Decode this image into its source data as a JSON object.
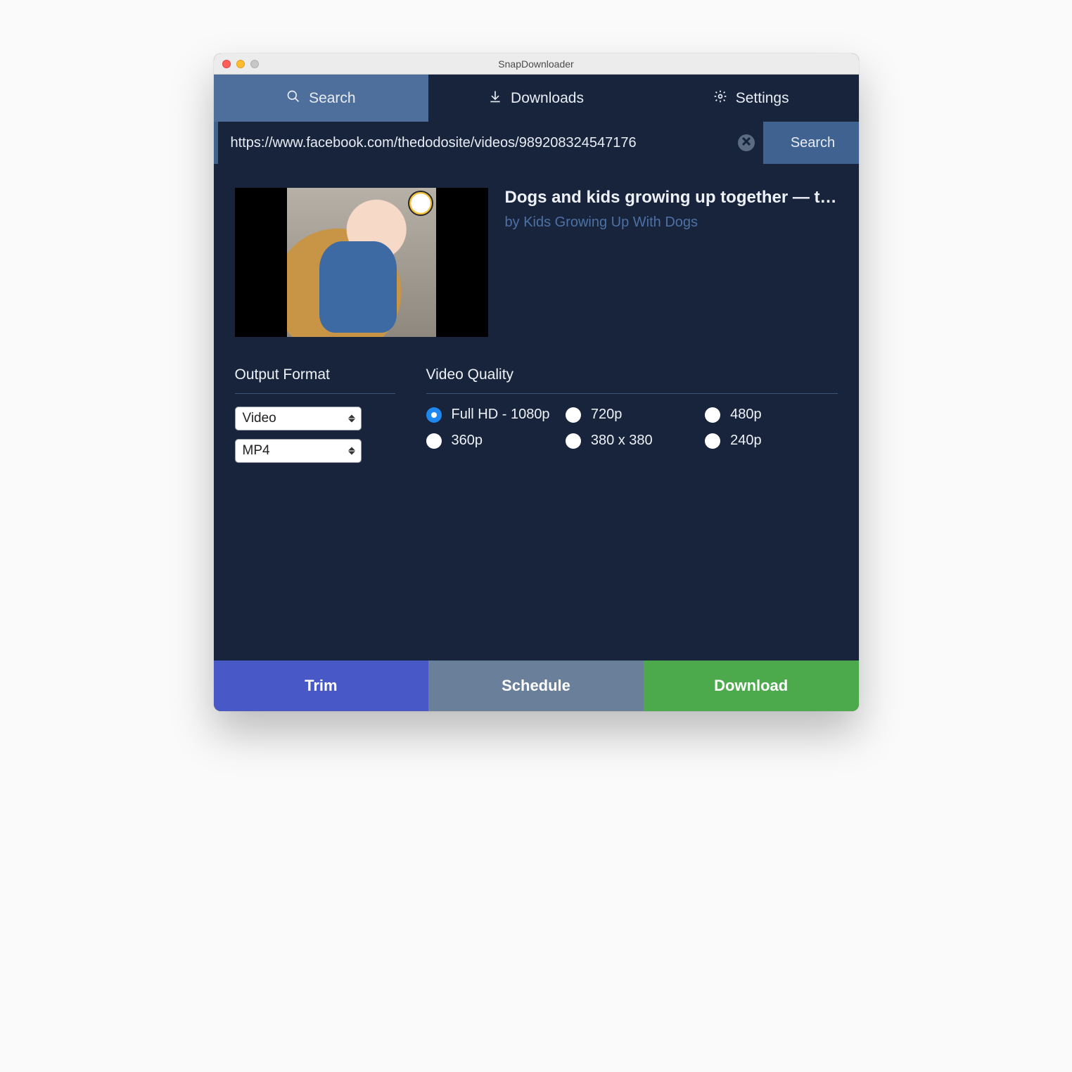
{
  "window": {
    "title": "SnapDownloader"
  },
  "tabs": {
    "search": "Search",
    "downloads": "Downloads",
    "settings": "Settings",
    "active": "search"
  },
  "search": {
    "url": "https://www.facebook.com/thedodosite/videos/989208324547176",
    "button": "Search"
  },
  "video": {
    "title": "Dogs and kids growing up together — this is w…",
    "by_prefix": "by ",
    "author": "Kids Growing Up With Dogs"
  },
  "format": {
    "section": "Output Format",
    "type": "Video",
    "container": "MP4"
  },
  "quality": {
    "section": "Video Quality",
    "options": [
      {
        "label": "Full HD - 1080p",
        "selected": true
      },
      {
        "label": "720p",
        "selected": false
      },
      {
        "label": "480p",
        "selected": false
      },
      {
        "label": "360p",
        "selected": false
      },
      {
        "label": "380 x 380",
        "selected": false
      },
      {
        "label": "240p",
        "selected": false
      }
    ]
  },
  "actions": {
    "trim": "Trim",
    "schedule": "Schedule",
    "download": "Download"
  }
}
